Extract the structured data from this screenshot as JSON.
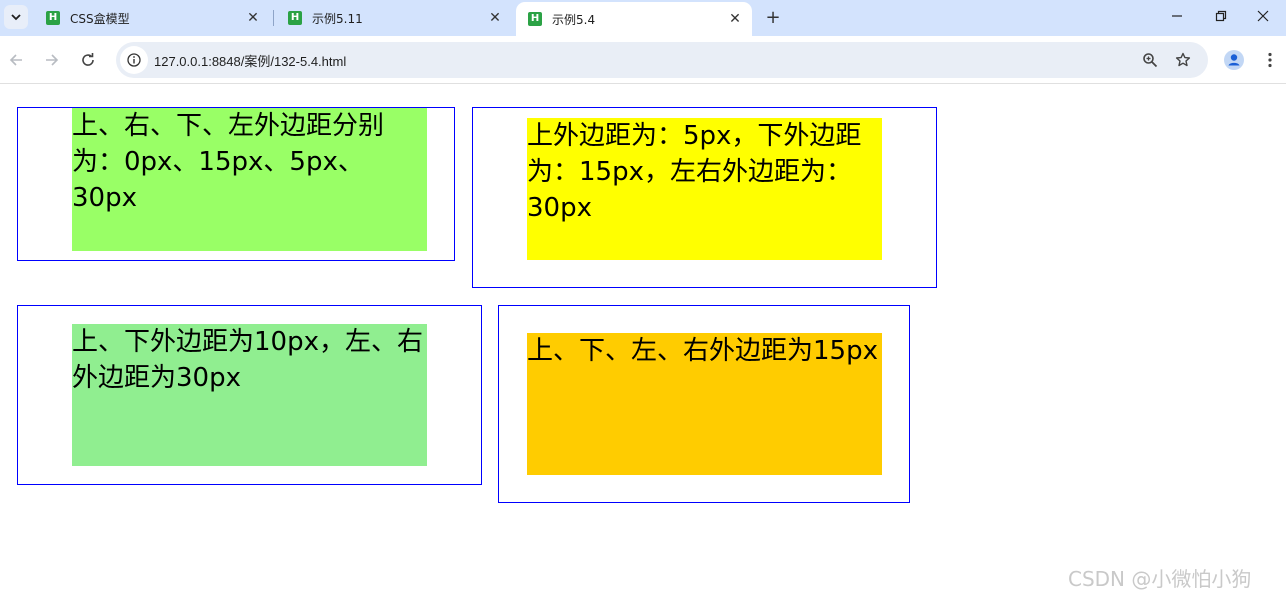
{
  "browser": {
    "tabs": [
      {
        "title": "CSS盒模型",
        "favicon_letter": "H"
      },
      {
        "title": "示例5.11",
        "favicon_letter": "H"
      },
      {
        "title": "示例5.4",
        "favicon_letter": "H",
        "active": true
      }
    ],
    "new_tab_icon": "plus-icon",
    "address": "127.0.0.1:8848/案例/132-5.4.html",
    "accent": "#d3e3fd"
  },
  "page": {
    "boxes": [
      {
        "text": "上、右、下、左外边距分别为：0px、15px、5px、30px",
        "color": "#99ff66"
      },
      {
        "text": "上外边距为：5px，下外边距为：15px，左右外边距为：30px",
        "color": "#ffff00"
      },
      {
        "text": "上、下外边距为10px，左、右外边距为30px",
        "color": "#90ee90"
      },
      {
        "text": "上、下、左、右外边距为15px",
        "color": "#ffcc00"
      }
    ],
    "border_color": "#0000ff"
  },
  "watermark": "CSDN @小微怕小狗"
}
